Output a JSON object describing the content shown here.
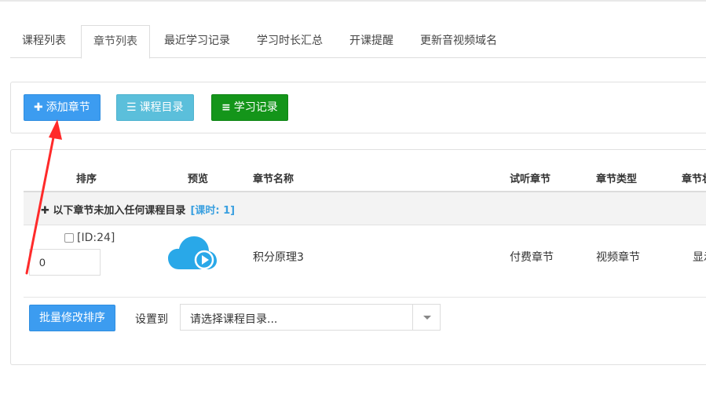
{
  "tabs": [
    {
      "label": "课程列表"
    },
    {
      "label": "章节列表"
    },
    {
      "label": "最近学习记录"
    },
    {
      "label": "学习时长汇总"
    },
    {
      "label": "开课提醒"
    },
    {
      "label": "更新音视频域名"
    }
  ],
  "active_tab": "章节列表",
  "toolbar": {
    "add_label": "添加章节",
    "catalog_label": "课程目录",
    "records_label": "学习记录"
  },
  "table": {
    "headers": {
      "sort": "排序",
      "preview": "预览",
      "name": "章节名称",
      "trial": "试听章节",
      "type": "章节类型",
      "status": "章节状"
    },
    "group": {
      "text": "以下章节未加入任何课程目录",
      "hours": "[课时: 1]"
    },
    "rows": [
      {
        "id_label": "[ID:24]",
        "sort_value": "0",
        "name": "积分原理3",
        "trial": "付费章节",
        "type": "视频章节",
        "status": "显示"
      }
    ]
  },
  "footer": {
    "batch_label": "批量修改排序",
    "set_label": "设置到",
    "select_value": "请选择课程目录..."
  },
  "colors": {
    "primary": "#3c9cf0",
    "info": "#5bbfdb",
    "success": "#14951a",
    "arrow": "#ff2a2a",
    "cloud": "#29a8e8"
  }
}
